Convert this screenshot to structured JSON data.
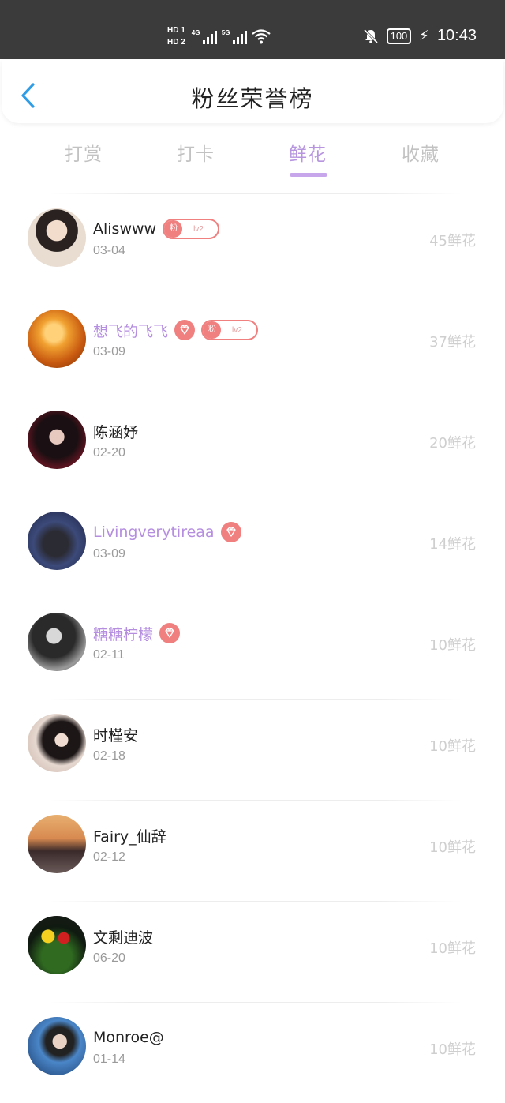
{
  "status_bar": {
    "hd1": "HD 1",
    "hd2": "HD 2",
    "net1": "4G",
    "net2": "5G",
    "battery": "100",
    "time": "10:43"
  },
  "header": {
    "title": "粉丝荣誉榜",
    "back_icon": "chevron-left-icon"
  },
  "tabs": [
    {
      "label": "打赏",
      "active": false
    },
    {
      "label": "打卡",
      "active": false
    },
    {
      "label": "鲜花",
      "active": true
    },
    {
      "label": "收藏",
      "active": false
    }
  ],
  "colors": {
    "accent": "#b796df",
    "badge": "#f07f7f",
    "status_bar": "#3b3b3b"
  },
  "fans": [
    {
      "name": "Aliswww",
      "date": "03-04",
      "count": "45鲜花",
      "vip": false,
      "fan_badge": {
        "fan": "粉",
        "level": "lv2"
      }
    },
    {
      "name": "想飞的飞飞",
      "date": "03-09",
      "count": "37鲜花",
      "vip": true,
      "fan_badge": {
        "fan": "粉",
        "level": "lv2"
      }
    },
    {
      "name": "陈涵妤",
      "date": "02-20",
      "count": "20鲜花",
      "vip": false
    },
    {
      "name": "Livingverytireaa",
      "date": "03-09",
      "count": "14鲜花",
      "vip": true
    },
    {
      "name": "糖糖柠檬",
      "date": "02-11",
      "count": "10鲜花",
      "vip": true
    },
    {
      "name": "时槿安",
      "date": "02-18",
      "count": "10鲜花",
      "vip": false
    },
    {
      "name": "Fairy_仙辞",
      "date": "02-12",
      "count": "10鲜花",
      "vip": false
    },
    {
      "name": "文剩迪波",
      "date": "06-20",
      "count": "10鲜花",
      "vip": false
    },
    {
      "name": "Monroe@",
      "date": "01-14",
      "count": "10鲜花",
      "vip": false
    }
  ]
}
